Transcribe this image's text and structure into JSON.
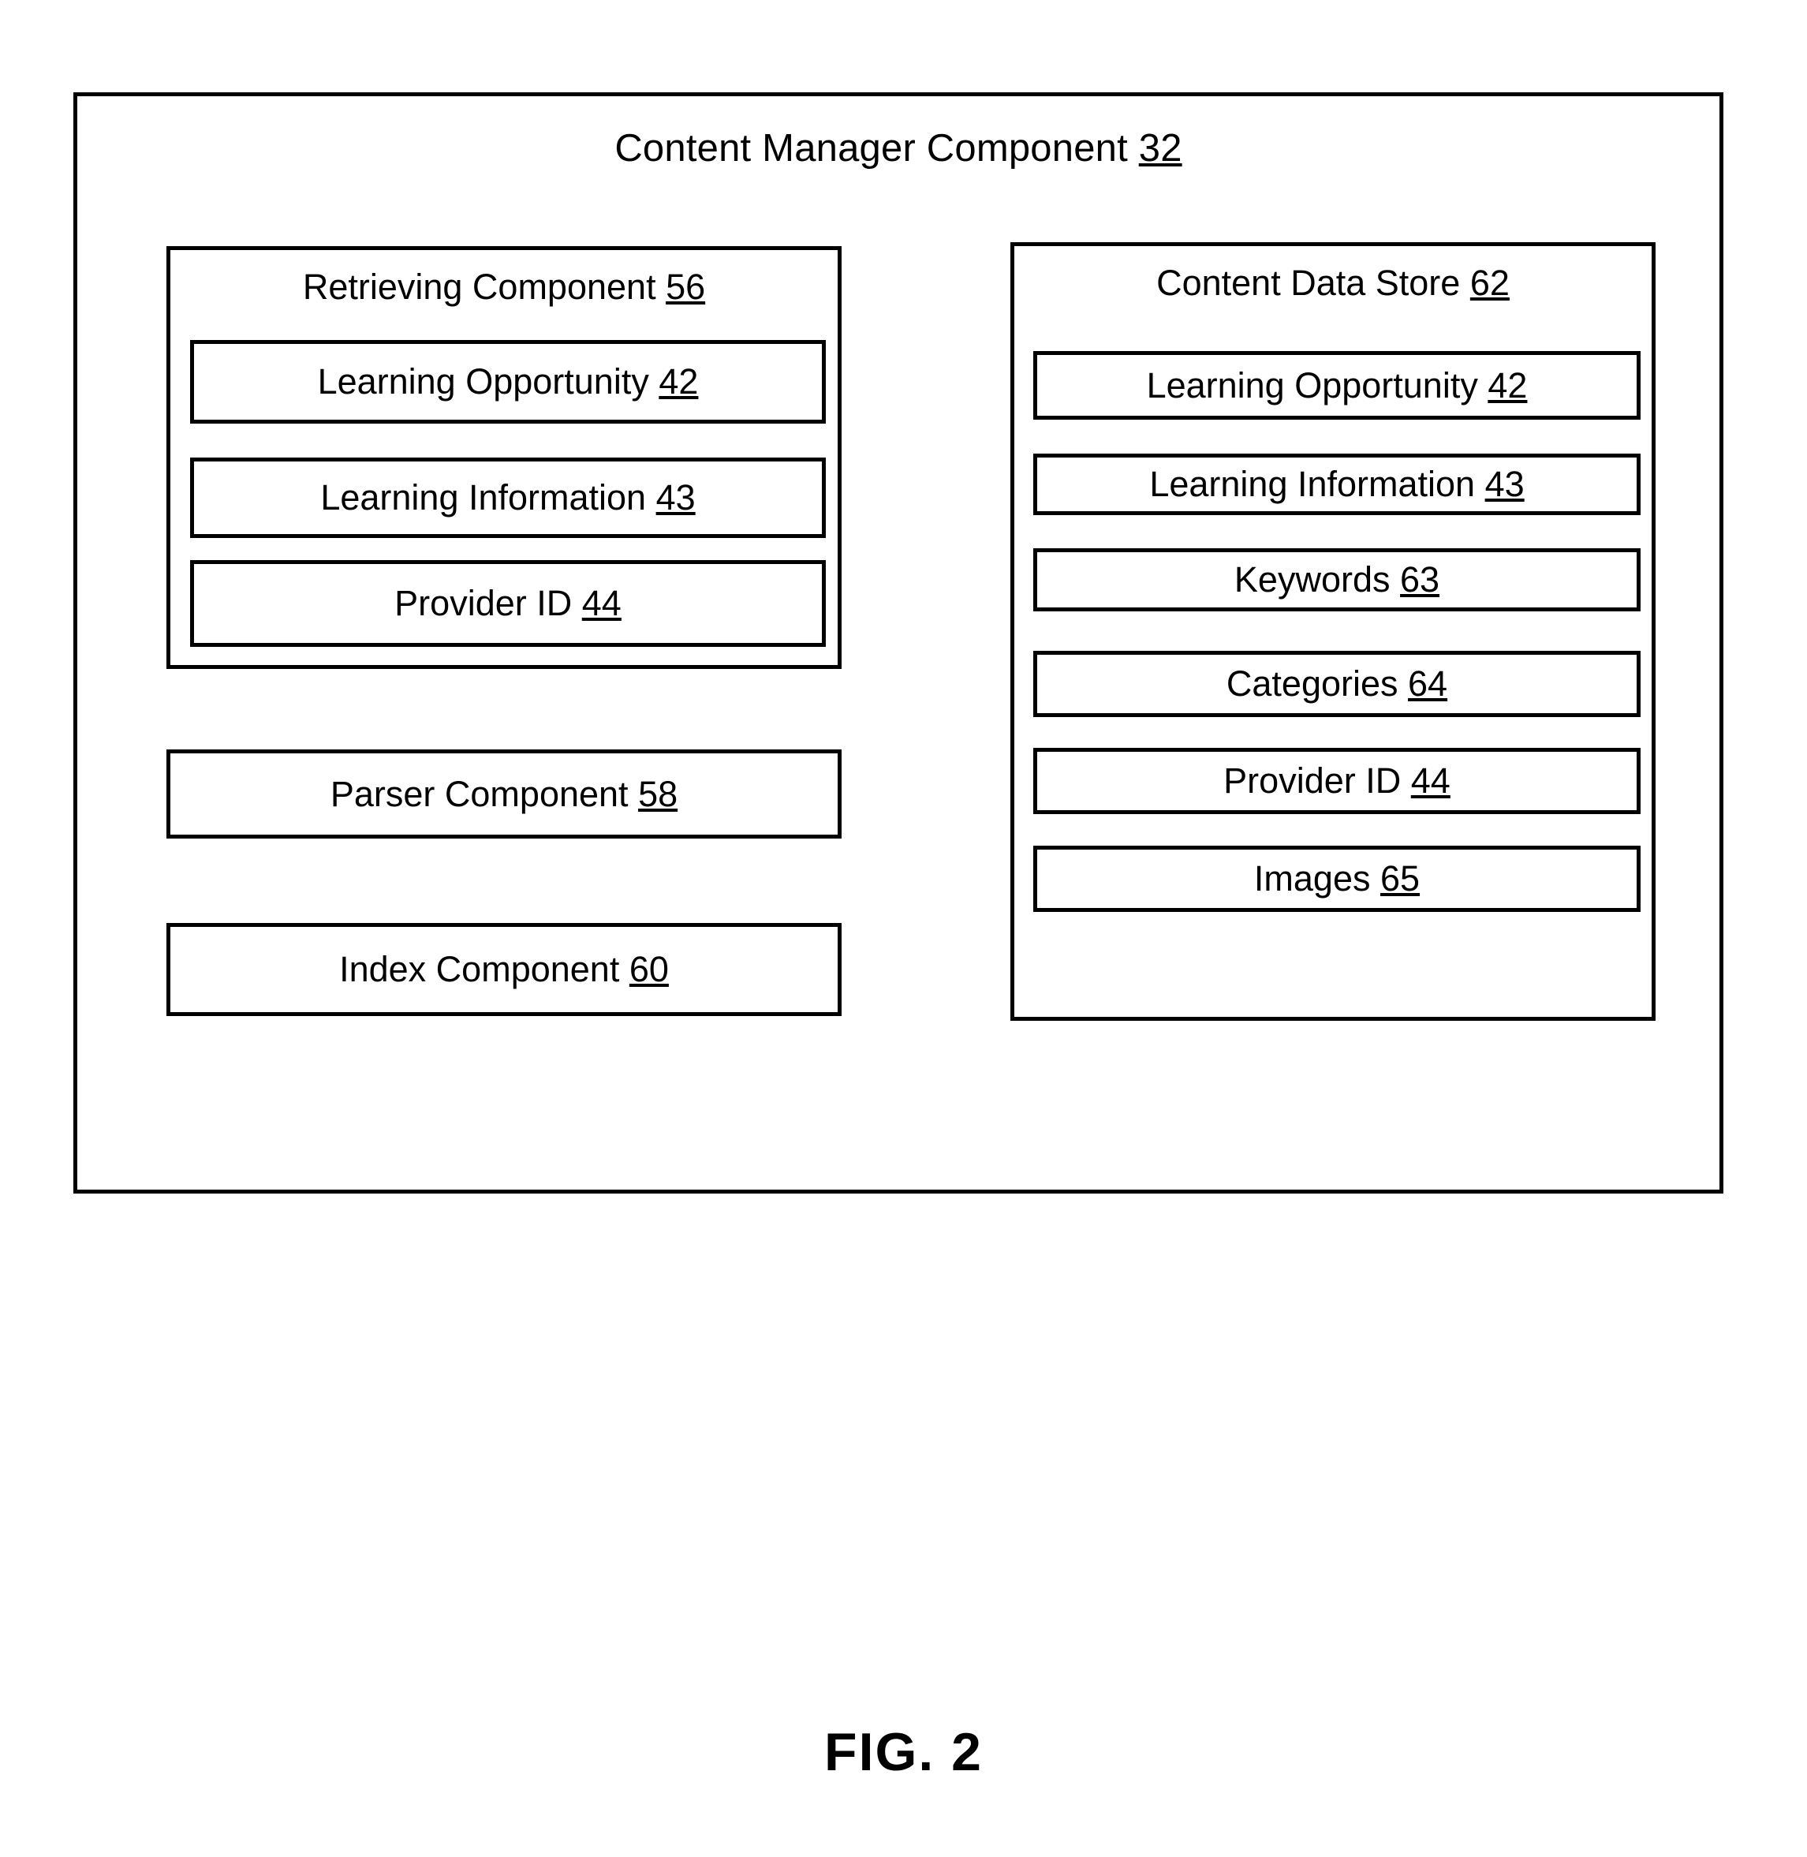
{
  "figure": {
    "caption": "FIG. 2",
    "frame_title": {
      "text": "Content Manager Component",
      "ref": "32",
      "full": "Content Manager Component 32"
    }
  },
  "colors": {
    "stroke": "#000000",
    "background": "#ffffff",
    "text": "#000000"
  },
  "blocks": {
    "retrieving_component": {
      "title": "Retrieving Component",
      "ref": "56",
      "children": [
        {
          "label": "Learning Opportunity",
          "ref": "42"
        },
        {
          "label": "Learning Information",
          "ref": "43"
        },
        {
          "label": "Provider ID",
          "ref": "44"
        }
      ]
    },
    "parser_component": {
      "title": "Parser Component",
      "ref": "58"
    },
    "index_component": {
      "title": "Index Component",
      "ref": "60"
    },
    "content_data_store": {
      "title": "Content Data Store",
      "ref": "62",
      "children": [
        {
          "label": "Learning Opportunity",
          "ref": "42"
        },
        {
          "label": "Learning Information",
          "ref": "43"
        },
        {
          "label": "Keywords",
          "ref": "63"
        },
        {
          "label": "Categories",
          "ref": "64"
        },
        {
          "label": "Provider ID",
          "ref": "44"
        },
        {
          "label": "Images",
          "ref": "65"
        }
      ]
    }
  }
}
